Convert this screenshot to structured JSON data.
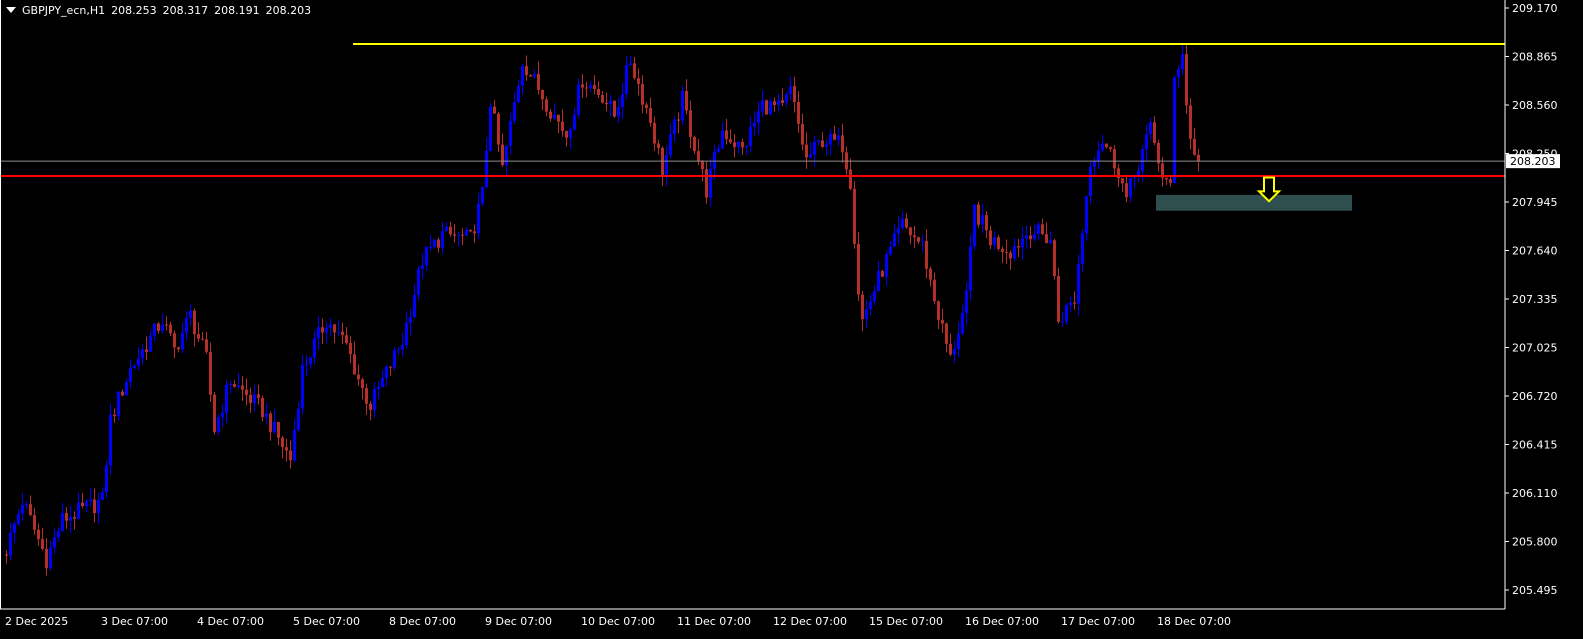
{
  "header": {
    "symbol": "GBPJPY_ecn,H1",
    "open": "208.253",
    "high": "208.317",
    "low": "208.191",
    "close": "208.203"
  },
  "colors": {
    "background": "#000000",
    "axis": "#ffffff",
    "bull": "#0000ff",
    "bear": "#b5302a",
    "resistance": "#ffff00",
    "support": "#ff0000",
    "bid_line": "#8c8c8c",
    "zone": "#2f4f4f",
    "arrow": "#ffff00"
  },
  "chart_data": {
    "type": "candlestick",
    "title": "GBPJPY_ecn,H1",
    "ylim": [
      205.495,
      209.17
    ],
    "y_ticks": [
      "209.170",
      "208.865",
      "208.560",
      "208.250",
      "207.945",
      "207.640",
      "207.335",
      "207.025",
      "206.720",
      "206.415",
      "206.110",
      "205.800",
      "205.495"
    ],
    "x_ticks": [
      {
        "bar": 0,
        "label": "2 Dec 2025"
      },
      {
        "bar": 24,
        "label": "3 Dec 07:00"
      },
      {
        "bar": 48,
        "label": "4 Dec 07:00"
      },
      {
        "bar": 72,
        "label": "5 Dec 07:00"
      },
      {
        "bar": 96,
        "label": "8 Dec 07:00"
      },
      {
        "bar": 120,
        "label": "9 Dec 07:00"
      },
      {
        "bar": 144,
        "label": "10 Dec 07:00"
      },
      {
        "bar": 168,
        "label": "11 Dec 07:00"
      },
      {
        "bar": 192,
        "label": "12 Dec 07:00"
      },
      {
        "bar": 216,
        "label": "15 Dec 07:00"
      },
      {
        "bar": 240,
        "label": "16 Dec 07:00"
      },
      {
        "bar": 264,
        "label": "17 Dec 07:00"
      },
      {
        "bar": 288,
        "label": "18 Dec 07:00"
      }
    ],
    "bar_count": 299,
    "close_path": [
      [
        0,
        205.75
      ],
      [
        4,
        206.06
      ],
      [
        10,
        205.69
      ],
      [
        14,
        205.94
      ],
      [
        24,
        206.06
      ],
      [
        26,
        206.57
      ],
      [
        31,
        206.89
      ],
      [
        39,
        207.2
      ],
      [
        42,
        207.01
      ],
      [
        46,
        207.23
      ],
      [
        50,
        206.95
      ],
      [
        52,
        206.51
      ],
      [
        56,
        206.82
      ],
      [
        64,
        206.63
      ],
      [
        71,
        206.32
      ],
      [
        74,
        206.89
      ],
      [
        80,
        207.2
      ],
      [
        85,
        207.04
      ],
      [
        89,
        206.76
      ],
      [
        91,
        206.66
      ],
      [
        99,
        207.07
      ],
      [
        104,
        207.58
      ],
      [
        109,
        207.74
      ],
      [
        116,
        207.71
      ],
      [
        119,
        207.99
      ],
      [
        121,
        208.59
      ],
      [
        124,
        208.15
      ],
      [
        129,
        208.84
      ],
      [
        136,
        208.53
      ],
      [
        140,
        208.37
      ],
      [
        144,
        208.72
      ],
      [
        149,
        208.62
      ],
      [
        152,
        208.49
      ],
      [
        156,
        208.84
      ],
      [
        161,
        208.46
      ],
      [
        164,
        208.15
      ],
      [
        169,
        208.59
      ],
      [
        175,
        208.02
      ],
      [
        179,
        208.4
      ],
      [
        184,
        208.27
      ],
      [
        189,
        208.56
      ],
      [
        194,
        208.53
      ],
      [
        196,
        208.65
      ],
      [
        200,
        208.21
      ],
      [
        204,
        208.34
      ],
      [
        209,
        208.31
      ],
      [
        211,
        208.08
      ],
      [
        213,
        207.39
      ],
      [
        214,
        207.2
      ],
      [
        219,
        207.52
      ],
      [
        224,
        207.8
      ],
      [
        229,
        207.67
      ],
      [
        232,
        207.33
      ],
      [
        236,
        206.95
      ],
      [
        240,
        207.33
      ],
      [
        242,
        207.9
      ],
      [
        246,
        207.71
      ],
      [
        251,
        207.64
      ],
      [
        256,
        207.77
      ],
      [
        261,
        207.71
      ],
      [
        263,
        207.2
      ],
      [
        267,
        207.33
      ],
      [
        271,
        208.21
      ],
      [
        274,
        208.34
      ],
      [
        278,
        208.15
      ],
      [
        280,
        207.96
      ],
      [
        284,
        208.27
      ],
      [
        286,
        208.4
      ],
      [
        289,
        208.12
      ],
      [
        291,
        208.02
      ],
      [
        292,
        208.72
      ],
      [
        294,
        208.91
      ],
      [
        295,
        208.56
      ],
      [
        296,
        208.34
      ],
      [
        298,
        208.203
      ]
    ],
    "bid_price": 208.203,
    "bid_label": "208.203",
    "resistance_level": 208.943,
    "resistance_start_bar": 87,
    "support_level": 208.109,
    "zone": {
      "top": 207.99,
      "bottom": 207.89,
      "start_bar": 288,
      "end_bar": 337
    },
    "arrow": {
      "bar": 316,
      "direction": "down",
      "price_top": 208.1,
      "price_bottom": 207.95
    }
  }
}
